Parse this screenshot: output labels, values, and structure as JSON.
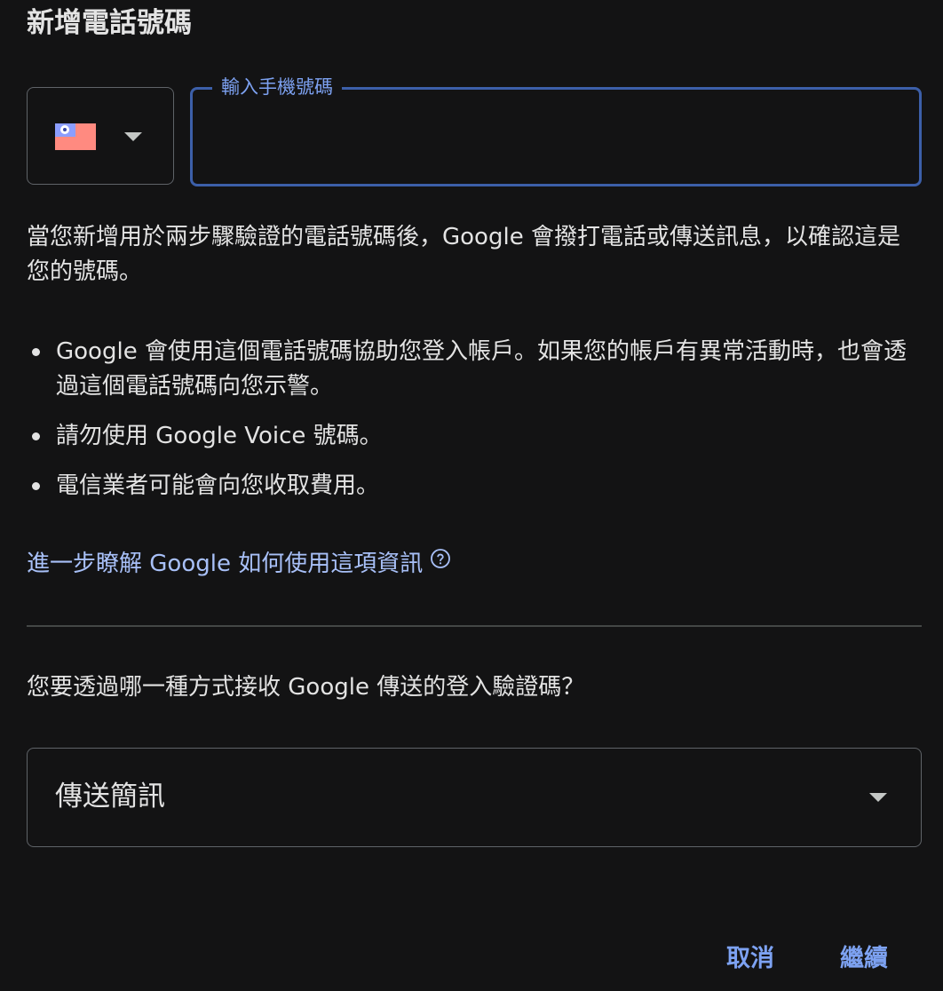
{
  "dialog": {
    "title": "新增電話號碼"
  },
  "phone": {
    "country_flag": "taiwan-flag-icon",
    "label": "輸入手機號碼",
    "value": "",
    "placeholder": ""
  },
  "description": "當您新增用於兩步驟驗證的電話號碼後，Google 會撥打電話或傳送訊息，以確認這是您的號碼。",
  "bullets": [
    "Google 會使用這個電話號碼協助您登入帳戶。如果您的帳戶有異常活動時，也會透過這個電話號碼向您示警。",
    "請勿使用 Google Voice 號碼。",
    "電信業者可能會向您收取費用。"
  ],
  "learn_more": {
    "label": "進一步瞭解 Google 如何使用這項資訊",
    "icon": "help-circle-icon"
  },
  "method": {
    "question": "您要透過哪一種方式接收 Google 傳送的登入驗證碼？",
    "selected": "傳送簡訊"
  },
  "actions": {
    "cancel_label": "取消",
    "continue_label": "繼續"
  },
  "colors": {
    "background": "#131314",
    "accent": "#7da2f2",
    "focused_border": "#3c5fa9",
    "link": "#a8c0f8",
    "text": "#e3e3e3"
  }
}
